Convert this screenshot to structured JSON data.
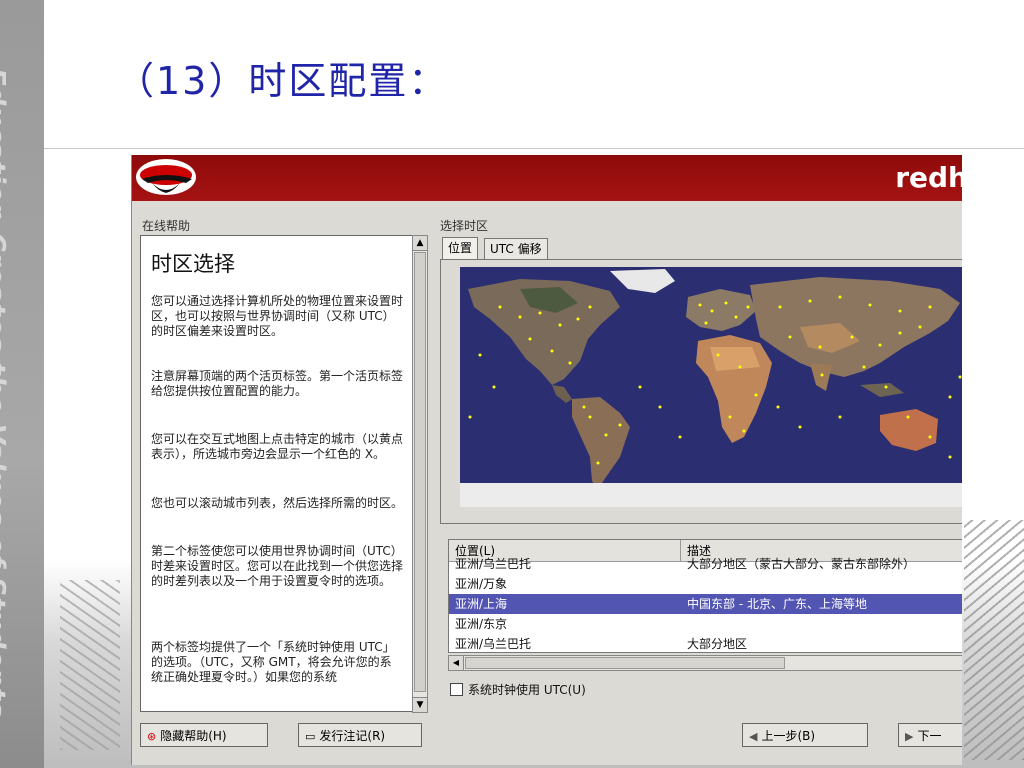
{
  "slide": {
    "side_text": "Education Creates the Values of Students",
    "title": "（13）时区配置："
  },
  "window": {
    "brand": "redh",
    "help_label": "在线帮助",
    "tz_label": "选择时区",
    "help": {
      "title": "时区选择",
      "paragraphs": [
        "您可以通过选择计算机所处的物理位置来设置时区，也可以按照与世界协调时间（又称 UTC）的时区偏差来设置时区。",
        "注意屏幕顶端的两个活页标签。第一个活页标签给您提供按位置配置的能力。",
        "您可以在交互式地图上点击特定的城市（以黄点表示），所选城市旁边会显示一个红色的 X。",
        "您也可以滚动城市列表，然后选择所需的时区。",
        "第二个标签使您可以使用世界协调时间（UTC）时差来设置时区。您可以在此找到一个供您选择的时差列表以及一个用于设置夏令时的选项。",
        "两个标签均提供了一个「系统时钟使用 UTC」的选项。（UTC，又称 GMT，将会允许您的系统正确处理夏令时。）如果您的系统"
      ]
    },
    "tabs": [
      "位置",
      "UTC 偏移"
    ],
    "list": {
      "columns": [
        "位置(L)",
        "描述"
      ],
      "rows": [
        {
          "location": "亚洲/乌兰巴托",
          "desc": "大部分地区（蒙古大部分、蒙古东部除外）"
        },
        {
          "location": "亚洲/万象",
          "desc": ""
        },
        {
          "location": "亚洲/上海",
          "desc": "中国东部 - 北京、广东、上海等地"
        },
        {
          "location": "亚洲/东京",
          "desc": ""
        },
        {
          "location": "亚洲/乌兰巴托",
          "desc": "大部分地区"
        }
      ],
      "selected_index": 2
    },
    "utc_checkbox": "系统时钟使用 UTC(U)",
    "buttons": {
      "hide_help": "隐藏帮助(H)",
      "release_notes": "发行注记(R)",
      "back": "上一步(B)",
      "next": "下一"
    }
  },
  "colors": {
    "title_blue": "#1f24a8",
    "banner_red": "#a51313",
    "selection": "#5355b3",
    "map_ocean": "#2b2f72",
    "city_dots": "#ffff00"
  }
}
